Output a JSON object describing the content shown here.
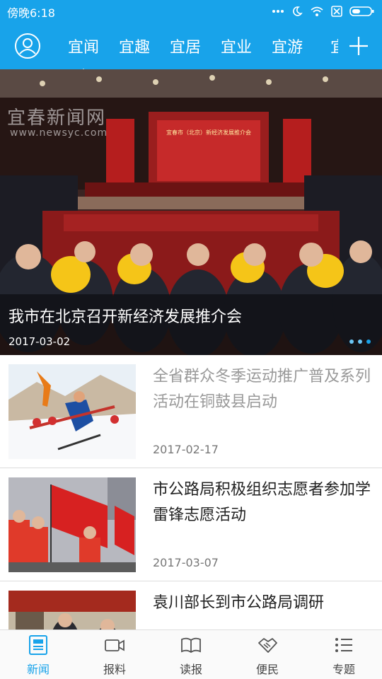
{
  "status_bar": {
    "time": "傍晚6:18"
  },
  "nav": {
    "tabs": [
      {
        "label": "宜闻",
        "active": true
      },
      {
        "label": "宜趣"
      },
      {
        "label": "宜居"
      },
      {
        "label": "宜业"
      },
      {
        "label": "宜游"
      },
      {
        "label": "宜"
      }
    ],
    "avatar_icon": "user-avatar-icon",
    "add_icon": "plus-icon"
  },
  "hero": {
    "title": "我市在北京召开新经济发展推介会",
    "date": "2017-03-02",
    "watermark": "宜春新闻网",
    "watermark_url": "www.newsyc.com",
    "banner_text": "宜春市（北京）新经济发展推介会",
    "slide_total": 3,
    "slide_current": 3
  },
  "news": [
    {
      "title": "全省群众冬季运动推广普及系列活动在铜鼓县启动",
      "date": "2017-02-17",
      "read": true
    },
    {
      "title": "市公路局积极组织志愿者参加学雷锋志愿活动",
      "date": "2017-03-07",
      "read": false
    },
    {
      "title": "袁川部长到市公路局调研",
      "date": "",
      "read": false
    }
  ],
  "bottom_nav": [
    {
      "label": "新闻",
      "icon": "newspaper-icon",
      "active": true
    },
    {
      "label": "报料",
      "icon": "video-camera-icon"
    },
    {
      "label": "读报",
      "icon": "open-book-icon"
    },
    {
      "label": "便民",
      "icon": "handshake-icon"
    },
    {
      "label": "专题",
      "icon": "list-icon"
    }
  ],
  "colors": {
    "primary": "#18a3ea",
    "text": "#222222",
    "read_text": "#999999"
  }
}
